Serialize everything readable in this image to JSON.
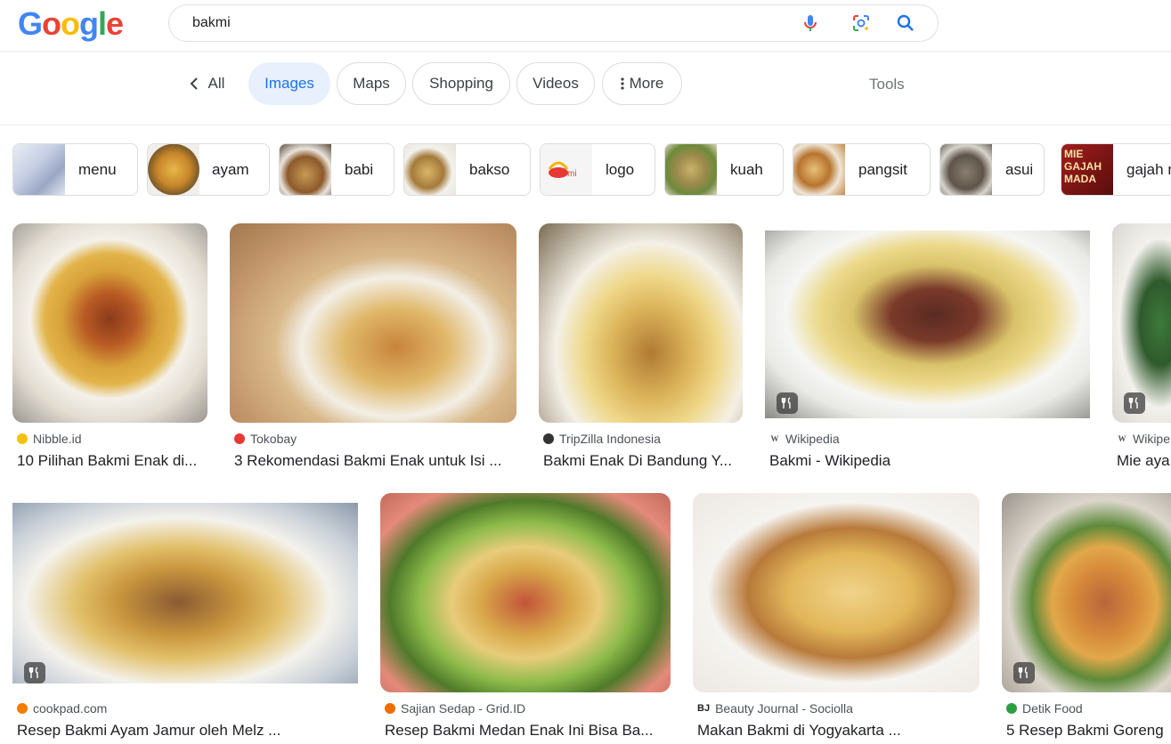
{
  "logo": {
    "letters": [
      "G",
      "o",
      "o",
      "g",
      "l",
      "e"
    ]
  },
  "search": {
    "query": "bakmi"
  },
  "tabs": {
    "back_label": "All",
    "items": [
      {
        "label": "Images",
        "active": true
      },
      {
        "label": "Maps"
      },
      {
        "label": "Shopping"
      },
      {
        "label": "Videos"
      },
      {
        "label": "More"
      }
    ],
    "tools_label": "Tools"
  },
  "chips": [
    {
      "label": "menu"
    },
    {
      "label": "ayam"
    },
    {
      "label": "babi"
    },
    {
      "label": "bakso"
    },
    {
      "label": "logo"
    },
    {
      "label": "kuah"
    },
    {
      "label": "pangsit"
    },
    {
      "label": "asui"
    },
    {
      "label": "gajah m",
      "thumb_text": "MIE GAJAH MADA"
    }
  ],
  "results_row1": [
    {
      "source": "Nibble.id",
      "title": "10 Pilihan Bakmi Enak di...",
      "favicon_color": "#f4c20d"
    },
    {
      "source": "Tokobay",
      "title": "3 Rekomendasi Bakmi Enak untuk Isi ...",
      "favicon_color": "#e53935"
    },
    {
      "source": "TripZilla Indonesia",
      "title": "Bakmi Enak Di Bandung Y...",
      "favicon_color": "#333333"
    },
    {
      "source": "Wikipedia",
      "title": "Bakmi - Wikipedia",
      "favicon_text": "W"
    },
    {
      "source": "Wikipe",
      "title": "Mie aya",
      "favicon_text": "W"
    }
  ],
  "results_row2": [
    {
      "source": "cookpad.com",
      "title": "Resep Bakmi Ayam Jamur oleh Melz ...",
      "favicon_color": "#f57c00"
    },
    {
      "source": "Sajian Sedap - Grid.ID",
      "title": "Resep Bakmi Medan Enak Ini Bisa Ba...",
      "favicon_color": "#ef6c00"
    },
    {
      "source": "Beauty Journal - Sociolla",
      "title": "Makan Bakmi di Yogyakarta ...",
      "favicon_text": "BJ"
    },
    {
      "source": "Detik Food",
      "title": "5 Resep Bakmi Goreng",
      "favicon_color": "#2e9e44"
    }
  ],
  "colors": {
    "accent": "#1a73e8",
    "active_tab_bg": "#e8f0fe"
  },
  "icons": [
    "mic-icon",
    "lens-icon",
    "search-icon",
    "chevron-left-icon",
    "more-vert-icon",
    "recipe-icon"
  ]
}
